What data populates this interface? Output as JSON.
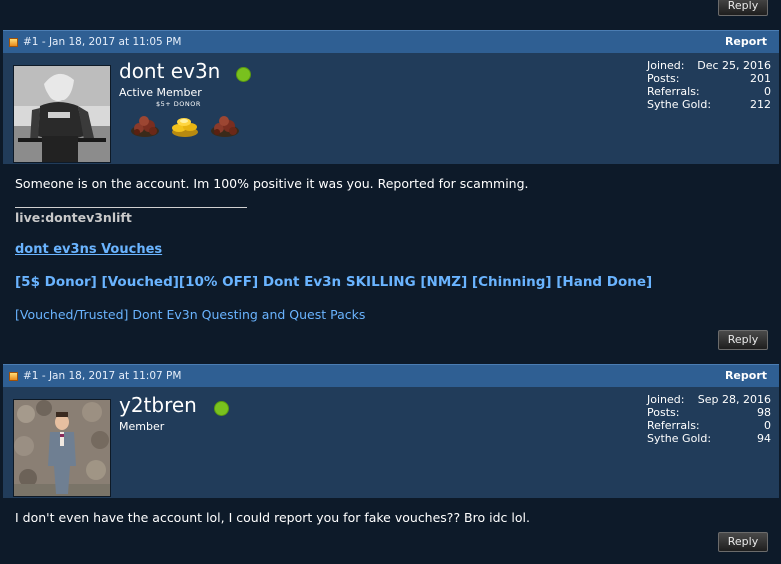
{
  "top": {
    "reply_label": "Reply"
  },
  "posts": [
    {
      "meta": "#1 - Jan 18, 2017 at 11:05 PM",
      "report_label": "Report",
      "username": "dont ev3n",
      "user_title": "Active Member",
      "donor_label": "$5+ DONOR",
      "badges": [
        "red-gem-pile-icon",
        "gold-coins-icon",
        "red-gem-pile-icon"
      ],
      "stats": [
        {
          "label": "Joined:",
          "value": "Dec 25, 2016"
        },
        {
          "label": "Posts:",
          "value": "201"
        },
        {
          "label": "Referrals:",
          "value": "0"
        },
        {
          "label": "Sythe Gold:",
          "value": "212"
        }
      ],
      "message": "Someone is on the account. Im 100% positive it was you. Reported for scamming.",
      "signature": {
        "live": "live:dontev3nlift",
        "vouches_link": "dont ev3ns Vouches",
        "thread_link": "[5$ Donor] [Vouched][10% OFF] Dont Ev3n SKILLING [NMZ] [Chinning] [Hand Done]",
        "questing_link": "[Vouched/Trusted] Dont Ev3n Questing and Quest Packs"
      },
      "reply_label": "Reply"
    },
    {
      "meta": "#1 - Jan 18, 2017 at 11:07 PM",
      "report_label": "Report",
      "username": "y2tbren",
      "user_title": "Member",
      "stats": [
        {
          "label": "Joined:",
          "value": "Sep 28, 2016"
        },
        {
          "label": "Posts:",
          "value": "98"
        },
        {
          "label": "Referrals:",
          "value": "0"
        },
        {
          "label": "Sythe Gold:",
          "value": "94"
        }
      ],
      "message": "I don't even have the account lol, I could report you for fake vouches?? Bro idc lol.",
      "reply_label": "Reply"
    }
  ],
  "colors": {
    "header_bar": "#2f5f93",
    "user_panel": "#213c5a",
    "background": "#0d1a29",
    "online": "#79c11e",
    "link": "#6ab4ff"
  }
}
